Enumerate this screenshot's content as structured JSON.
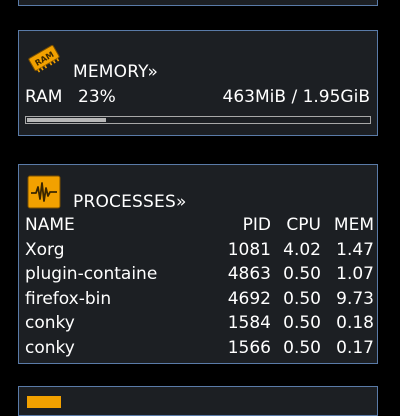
{
  "colors": {
    "panel_background": "#1c1f23",
    "panel_border": "#5a7ba8",
    "icon_accent": "#f2a100",
    "text": "#ffffff",
    "progress": "#b7b7b7"
  },
  "memory": {
    "icon": "ram-chip-icon",
    "icon_text": "RAM",
    "title": "MEMORY»",
    "ram_label": "RAM",
    "ram_percent": "23%",
    "usage": "463MiB / 1.95GiB",
    "progress_fraction": 0.23
  },
  "processes": {
    "icon": "activity-monitor-icon",
    "title": "PROCESSES»",
    "columns": [
      "NAME",
      "PID",
      "CPU",
      "MEM"
    ],
    "rows": [
      {
        "name": "Xorg",
        "pid": "1081",
        "cpu": "4.02",
        "mem": "1.47"
      },
      {
        "name": "plugin-containe",
        "pid": "4863",
        "cpu": "0.50",
        "mem": "1.07"
      },
      {
        "name": "firefox-bin",
        "pid": "4692",
        "cpu": "0.50",
        "mem": "9.73"
      },
      {
        "name": "conky",
        "pid": "1584",
        "cpu": "0.50",
        "mem": "0.18"
      },
      {
        "name": "conky",
        "pid": "1566",
        "cpu": "0.50",
        "mem": "0.17"
      }
    ]
  }
}
